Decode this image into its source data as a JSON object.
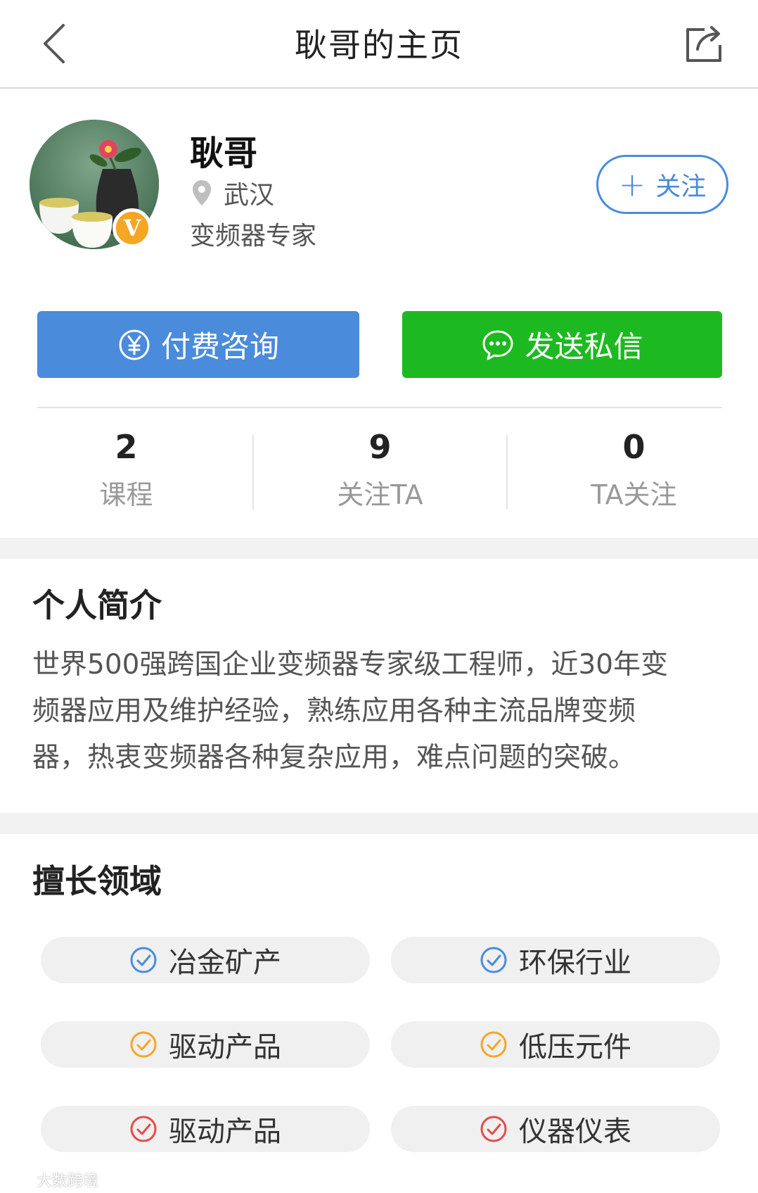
{
  "nav": {
    "back_icon": "chevron-left-icon",
    "title": "耿哥的主页",
    "share_icon": "share-icon"
  },
  "profile": {
    "avatar": "avatar-image",
    "badge": "V",
    "name": "耿哥",
    "location_icon": "location-pin-icon",
    "location": "武汉",
    "title": "变频器专家",
    "follow_label": "关注",
    "follow_icon": "plus-icon"
  },
  "actions": {
    "pay_label": "付费咨询",
    "pay_icon": "yen-circle-icon",
    "message_label": "发送私信",
    "message_icon": "chat-bubble-icon"
  },
  "stats": [
    {
      "value": "2",
      "label": "课程"
    },
    {
      "value": "9",
      "label": "关注TA"
    },
    {
      "value": "0",
      "label": "TA关注"
    }
  ],
  "intro": {
    "title": "个人简介",
    "lines": [
      "世界500强跨国企业变频器专家级工程师，近30年变",
      "频器应用及维护经验，熟练应用各种主流品牌变频",
      "器，热衷变频器各种复杂应用，难点问题的突破。"
    ]
  },
  "expertise": {
    "title": "擅长领域",
    "tags": [
      {
        "label": "冶金矿产",
        "color": "#4a8bdc"
      },
      {
        "label": "环保行业",
        "color": "#4a8bdc"
      },
      {
        "label": "驱动产品",
        "color": "#f5a623"
      },
      {
        "label": "低压元件",
        "color": "#f5a623"
      },
      {
        "label": "驱动产品",
        "color": "#e84a4a"
      },
      {
        "label": "仪器仪表",
        "color": "#e84a4a"
      }
    ]
  },
  "watermark": "大数跨境",
  "colors": {
    "accent_blue": "#4a8bdc",
    "accent_green": "#1db920",
    "badge_orange": "#f5a623"
  }
}
